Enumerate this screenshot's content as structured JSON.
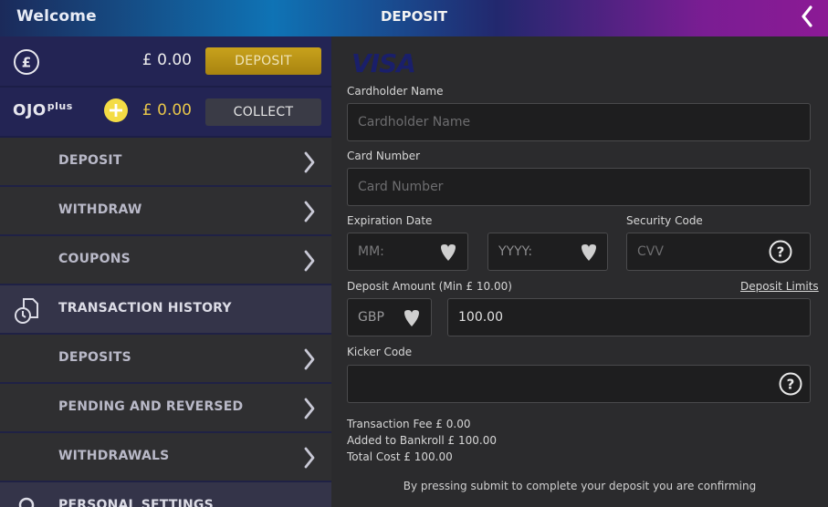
{
  "header": {
    "welcome": "Welcome",
    "title": "DEPOSIT",
    "back_icon": "chevron-left-icon"
  },
  "sidebar": {
    "balance": {
      "amount": "£ 0.00",
      "deposit_label": "DEPOSIT",
      "icon": "pound-icon"
    },
    "ojo_plus": {
      "brand": "OJO",
      "brand_sup": "plus",
      "amount": "£ 0.00",
      "collect_label": "COLLECT",
      "icon": "plus-coin-icon"
    },
    "items": [
      {
        "label": "DEPOSIT",
        "type": "item"
      },
      {
        "label": "WITHDRAW",
        "type": "item"
      },
      {
        "label": "COUPONS",
        "type": "item"
      },
      {
        "label": "TRANSACTION HISTORY",
        "type": "section",
        "icon": "transaction-history-icon"
      },
      {
        "label": "DEPOSITS",
        "type": "item"
      },
      {
        "label": "PENDING AND REVERSED",
        "type": "item"
      },
      {
        "label": "WITHDRAWALS",
        "type": "item"
      },
      {
        "label": "PERSONAL SETTINGS",
        "type": "section",
        "icon": "personal-settings-icon"
      }
    ]
  },
  "form": {
    "card_brand": "VISA",
    "cardholder_label": "Cardholder Name",
    "cardholder_placeholder": "Cardholder Name",
    "card_number_label": "Card Number",
    "card_number_placeholder": "Card Number",
    "expiration_label": "Expiration Date",
    "month_placeholder": "MM:",
    "year_placeholder": "YYYY:",
    "security_label": "Security Code",
    "cvv_placeholder": "CVV",
    "amount_label": "Deposit Amount  (Min  £ 10.00)",
    "deposit_limits": "Deposit Limits",
    "currency": "GBP",
    "amount_value": "100.00",
    "kicker_label": "Kicker Code",
    "kicker_value": "",
    "fee_line": "Transaction Fee  £ 0.00",
    "bankroll_line": "Added to Bankroll  £ 100.00",
    "total_line": "Total Cost  £ 100.00",
    "confirm_text": "By pressing submit to complete your deposit you are confirming"
  },
  "colors": {
    "gold_button": "#b8941a",
    "sidebar_dark_blue": "#232454",
    "visa_blue": "#1a1f6a"
  }
}
